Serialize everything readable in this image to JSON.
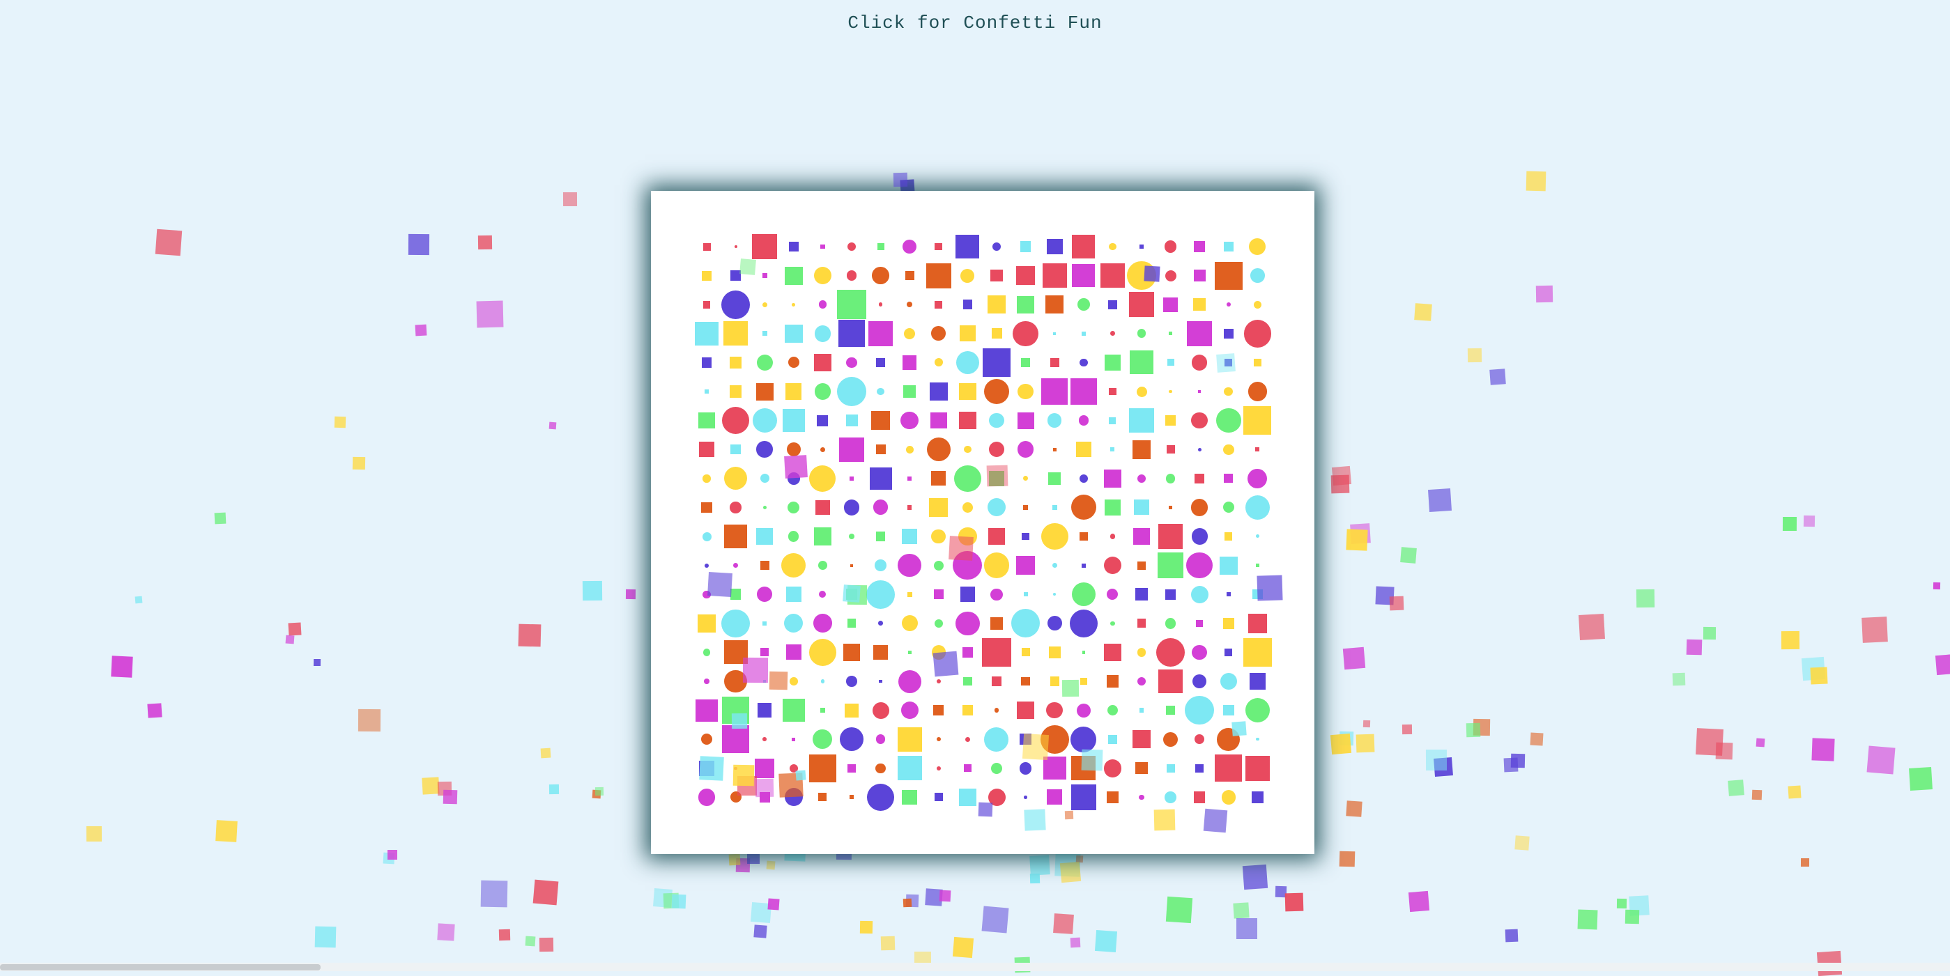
{
  "page": {
    "title": "Click for Confetti Fun",
    "background_color": "#e6f3fb",
    "card_color": "#ffffff"
  },
  "palette": {
    "red": "#e84a5f",
    "orange": "#e06020",
    "yellow": "#ffd93d",
    "green": "#6bef7b",
    "cyan": "#7de8f3",
    "purple": "#5b44d8",
    "magenta": "#d33fd6"
  },
  "scrollbar": {
    "label": "horizontal-scrollbar"
  }
}
